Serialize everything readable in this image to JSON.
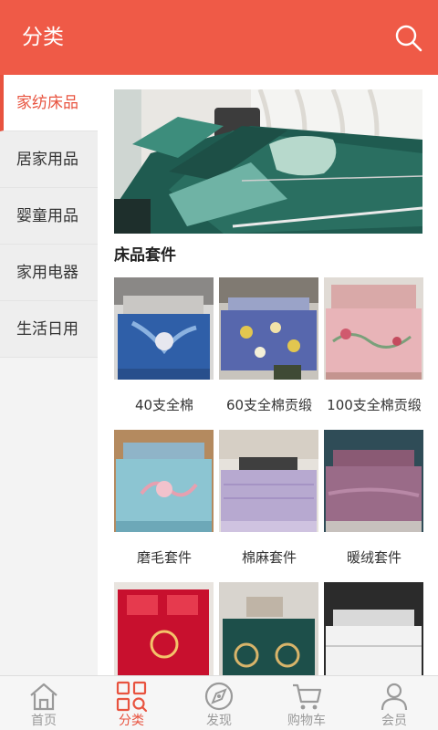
{
  "header": {
    "title": "分类",
    "search_icon": "search-icon"
  },
  "sidebar": {
    "items": [
      {
        "label": "家纺床品",
        "active": true
      },
      {
        "label": "居家用品",
        "active": false
      },
      {
        "label": "婴童用品",
        "active": false
      },
      {
        "label": "家用电器",
        "active": false
      },
      {
        "label": "生活日用",
        "active": false
      }
    ]
  },
  "main": {
    "section_title": "床品套件",
    "products": [
      {
        "label": "40支全棉"
      },
      {
        "label": "60支全棉贡缎"
      },
      {
        "label": "100支全棉贡缎"
      },
      {
        "label": "磨毛套件"
      },
      {
        "label": "棉麻套件"
      },
      {
        "label": "暖绒套件"
      },
      {
        "label": ""
      },
      {
        "label": ""
      },
      {
        "label": ""
      }
    ]
  },
  "tabbar": {
    "tabs": [
      {
        "label": "首页",
        "icon": "home-icon",
        "active": false
      },
      {
        "label": "分类",
        "icon": "category-icon",
        "active": true
      },
      {
        "label": "发现",
        "icon": "discover-icon",
        "active": false
      },
      {
        "label": "购物车",
        "icon": "cart-icon",
        "active": false
      },
      {
        "label": "会员",
        "icon": "member-icon",
        "active": false
      }
    ]
  },
  "colors": {
    "accent": "#ef5a47",
    "active_text": "#e8533f",
    "sidebar_bg": "#eeeeee",
    "inactive_tab": "#9a9a9a"
  }
}
